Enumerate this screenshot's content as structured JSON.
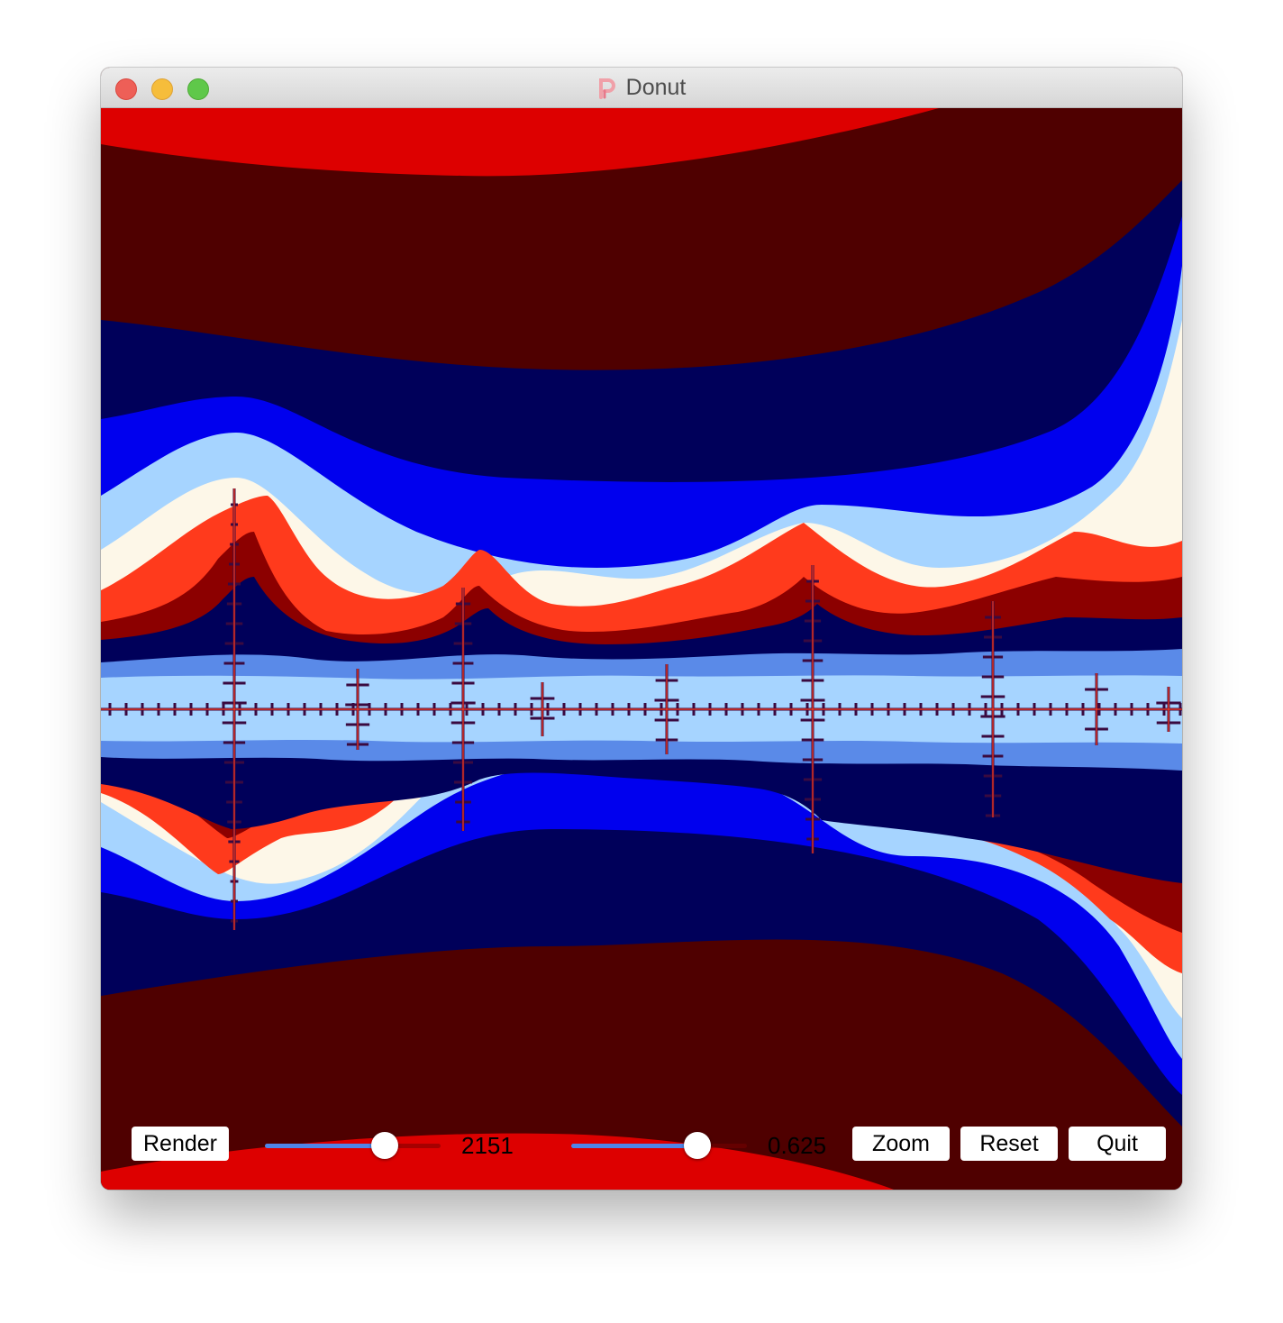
{
  "window": {
    "title": "Donut",
    "app_icon": "processing-p-icon"
  },
  "controls": {
    "render_label": "Render",
    "slider1": {
      "value_text": "2151",
      "fraction": 0.68
    },
    "slider2": {
      "value_text": "0.625",
      "fraction": 0.72
    },
    "zoom_label": "Zoom",
    "reset_label": "Reset",
    "quit_label": "Quit"
  },
  "colors": {
    "background_dark_red": "#4f0000",
    "red": "#dd0000",
    "navy": "#00005a",
    "blue": "#0000ee",
    "light_blue": "#a6d4ff",
    "cream": "#fdf7e8",
    "orange_red": "#ff3a1c",
    "dark_red": "#8c0000",
    "accent_slider": "#4f86e8"
  }
}
